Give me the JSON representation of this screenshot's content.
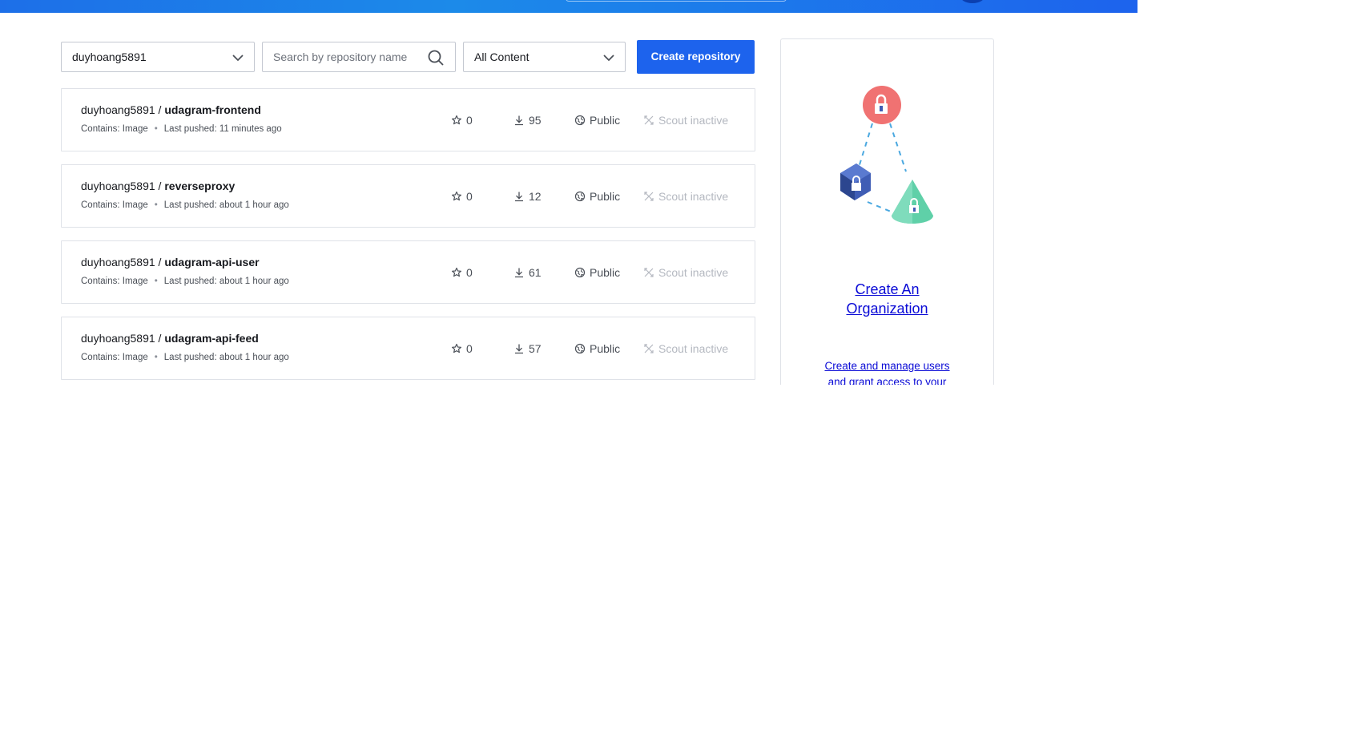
{
  "filters": {
    "namespace_value": "duyhoang5891",
    "search_placeholder": "Search by repository name",
    "content_value": "All Content",
    "create_button_label": "Create repository"
  },
  "repositories": [
    {
      "namespace": "duyhoang5891",
      "separator": " / ",
      "name": "udagram-frontend",
      "contains": "Contains: Image",
      "dot": "•",
      "last_pushed": "Last pushed: 11 minutes ago",
      "stars": "0",
      "pulls": "95",
      "visibility": "Public",
      "scout": "Scout inactive"
    },
    {
      "namespace": "duyhoang5891",
      "separator": " / ",
      "name": "reverseproxy",
      "contains": "Contains: Image",
      "dot": "•",
      "last_pushed": "Last pushed: about 1 hour ago",
      "stars": "0",
      "pulls": "12",
      "visibility": "Public",
      "scout": "Scout inactive"
    },
    {
      "namespace": "duyhoang5891",
      "separator": " / ",
      "name": "udagram-api-user",
      "contains": "Contains: Image",
      "dot": "•",
      "last_pushed": "Last pushed: about 1 hour ago",
      "stars": "0",
      "pulls": "61",
      "visibility": "Public",
      "scout": "Scout inactive"
    },
    {
      "namespace": "duyhoang5891",
      "separator": " / ",
      "name": "udagram-api-feed",
      "contains": "Contains: Image",
      "dot": "•",
      "last_pushed": "Last pushed: about 1 hour ago",
      "stars": "0",
      "pulls": "57",
      "visibility": "Public",
      "scout": "Scout inactive"
    }
  ],
  "organization_card": {
    "link_label": "Create An Organization",
    "description": "Create and manage users and grant access to your"
  },
  "colors": {
    "accent": "#1d63ed",
    "link": "#0a0ad6",
    "illustration_red": "#f07272",
    "illustration_blue": "#3f5db5",
    "illustration_green": "#5fd0a8"
  }
}
